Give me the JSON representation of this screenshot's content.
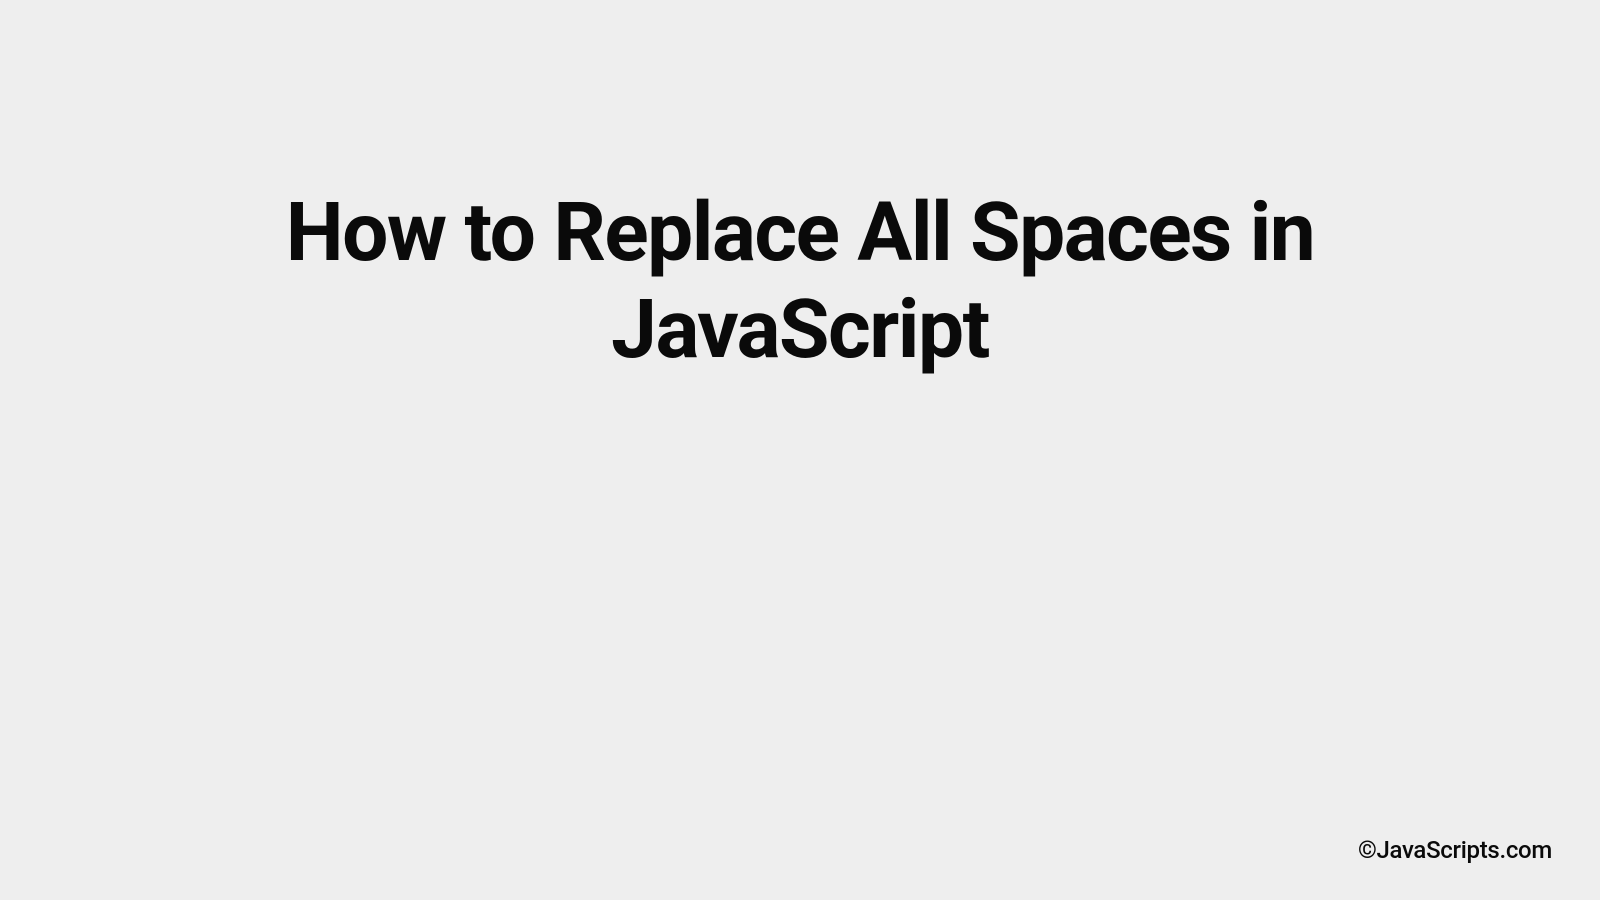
{
  "title": "How to Replace All Spaces in JavaScript",
  "footer": "©JavaScripts.com"
}
